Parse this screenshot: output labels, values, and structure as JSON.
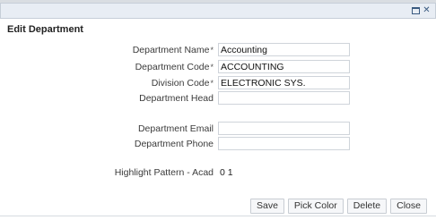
{
  "window": {
    "controls": [
      {
        "name": "maximize-icon"
      },
      {
        "name": "close-icon",
        "glyph": "✕"
      }
    ]
  },
  "form": {
    "title": "Edit Department",
    "required_marker": "*",
    "fields": {
      "department_name": {
        "label": "Department Name",
        "value": "Accounting",
        "required": true
      },
      "department_code": {
        "label": "Department Code",
        "value": "ACCOUNTING",
        "required": true
      },
      "division_code": {
        "label": "Division Code",
        "value": "ELECTRONIC SYS.",
        "required": true
      },
      "department_head": {
        "label": "Department Head",
        "value": ""
      },
      "department_email": {
        "label": "Department Email",
        "value": ""
      },
      "department_phone": {
        "label": "Department Phone",
        "value": ""
      },
      "highlight_pattern": {
        "label": "Highlight Pattern - Acad",
        "value": "0 1"
      }
    }
  },
  "buttons": {
    "save": "Save",
    "pick_color": "Pick Color",
    "delete": "Delete",
    "close": "Close"
  },
  "colors": {
    "titlebar_bg": "#e8edf4",
    "control_icon": "#3a5a80",
    "input_border": "#cfd4da"
  }
}
